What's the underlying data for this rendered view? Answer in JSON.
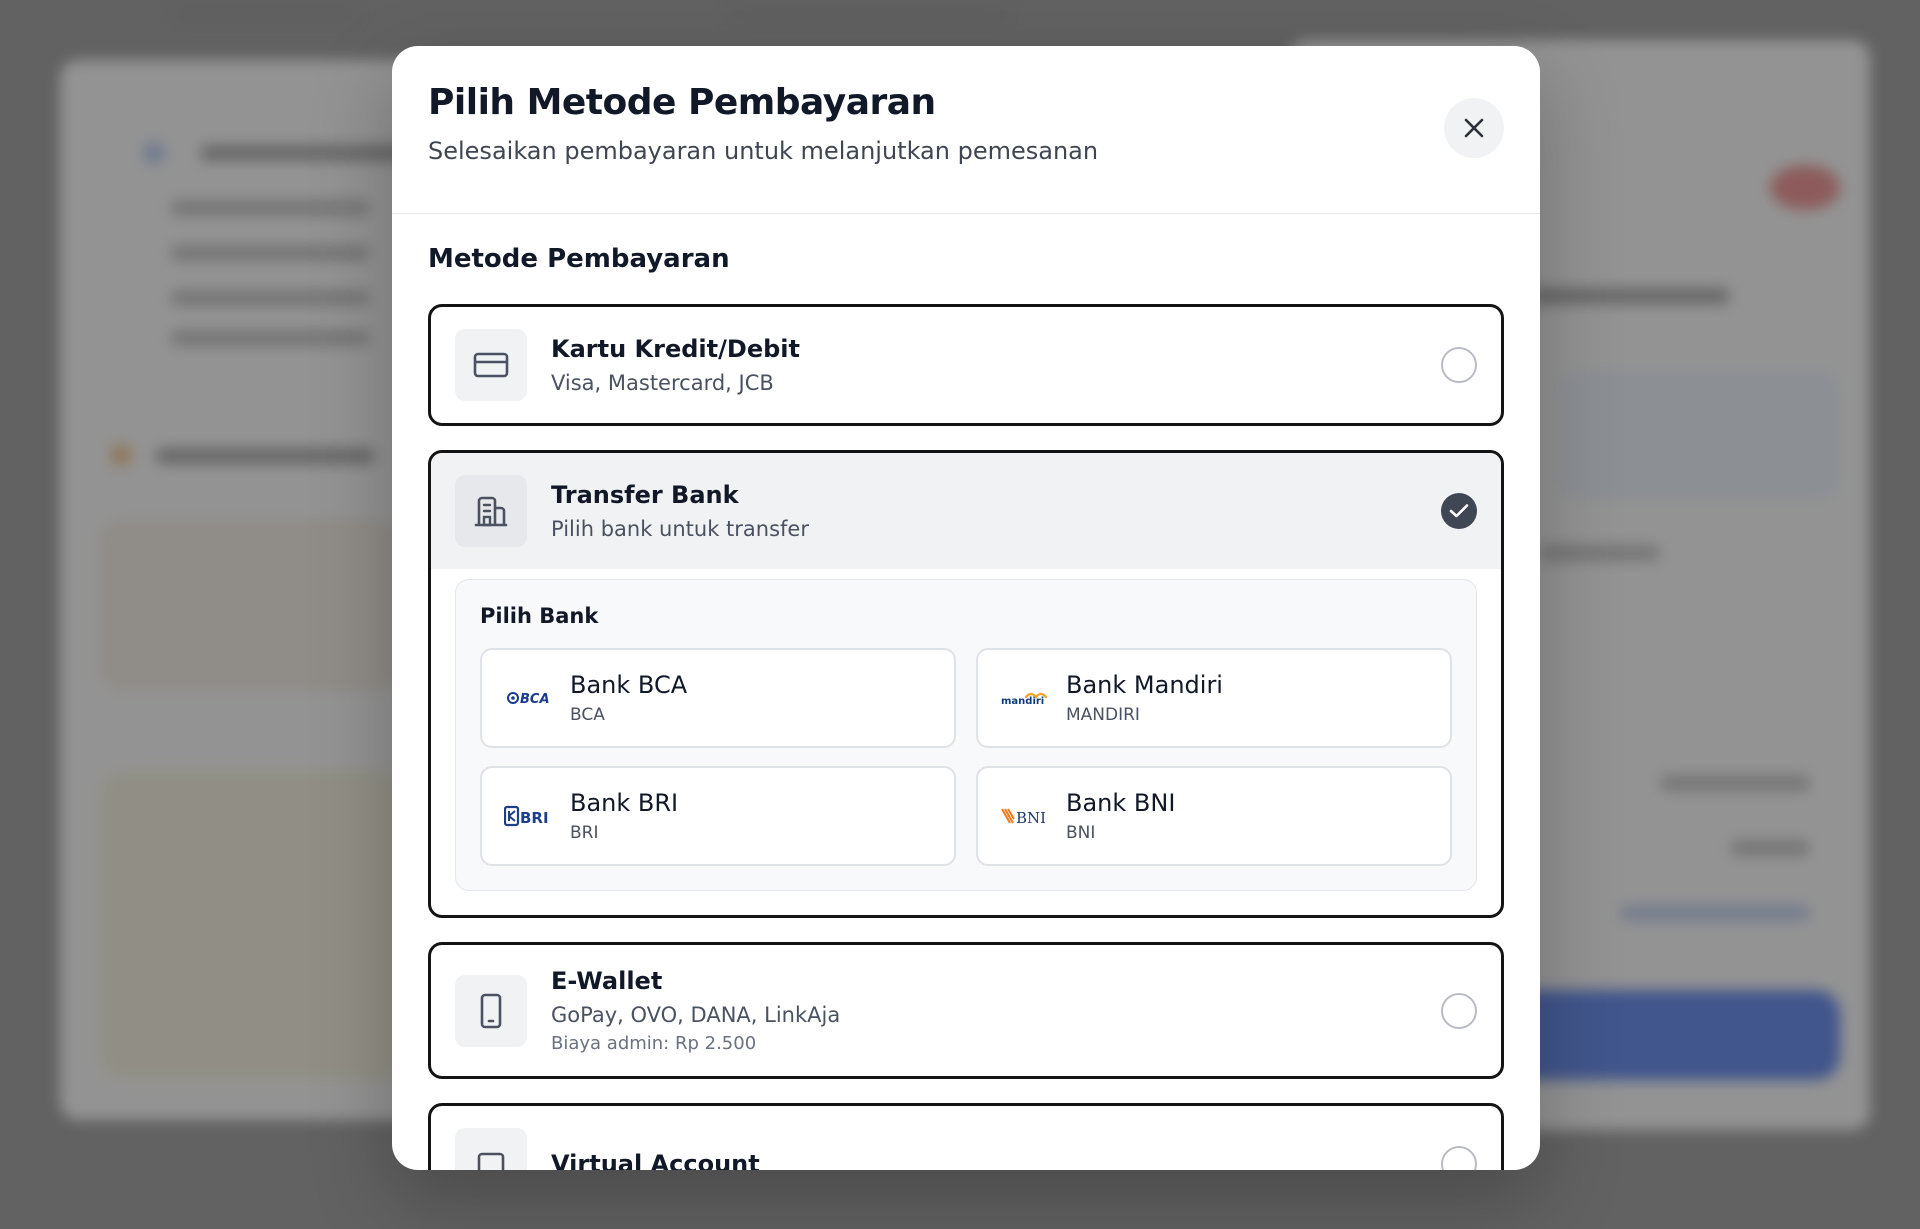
{
  "modal": {
    "title": "Pilih Metode Pembayaran",
    "subtitle": "Selesaikan pembayaran untuk melanjutkan pemesanan",
    "section_title": "Metode Pembayaran"
  },
  "methods": [
    {
      "name": "Kartu Kredit/Debit",
      "desc": "Visa, Mastercard, JCB",
      "icon": "credit-card-icon",
      "selected": false
    },
    {
      "name": "Transfer Bank",
      "desc": "Pilih bank untuk transfer",
      "icon": "bank-building-icon",
      "selected": true
    },
    {
      "name": "E-Wallet",
      "desc": "GoPay, OVO, DANA, LinkAja",
      "fee": "Biaya admin: Rp 2.500",
      "icon": "smartphone-icon",
      "selected": false
    },
    {
      "name": "Virtual Account",
      "icon": "virtual-account-icon",
      "selected": false
    }
  ],
  "bank_panel": {
    "title": "Pilih Bank",
    "banks": [
      {
        "name": "Bank BCA",
        "code": "BCA",
        "logo_text": "BCA",
        "logo_color": "#1a3c8f"
      },
      {
        "name": "Bank Mandiri",
        "code": "MANDIRI",
        "logo_text": "mandiri",
        "logo_color": "#0d3a7a"
      },
      {
        "name": "Bank BRI",
        "code": "BRI",
        "logo_text": "BRI",
        "logo_color": "#1d3f8a"
      },
      {
        "name": "Bank BNI",
        "code": "BNI",
        "logo_text": "BNI",
        "logo_color": "#1b3b6b"
      }
    ]
  },
  "colors": {
    "accent_selected": "#3f4654",
    "border": "#141414"
  }
}
